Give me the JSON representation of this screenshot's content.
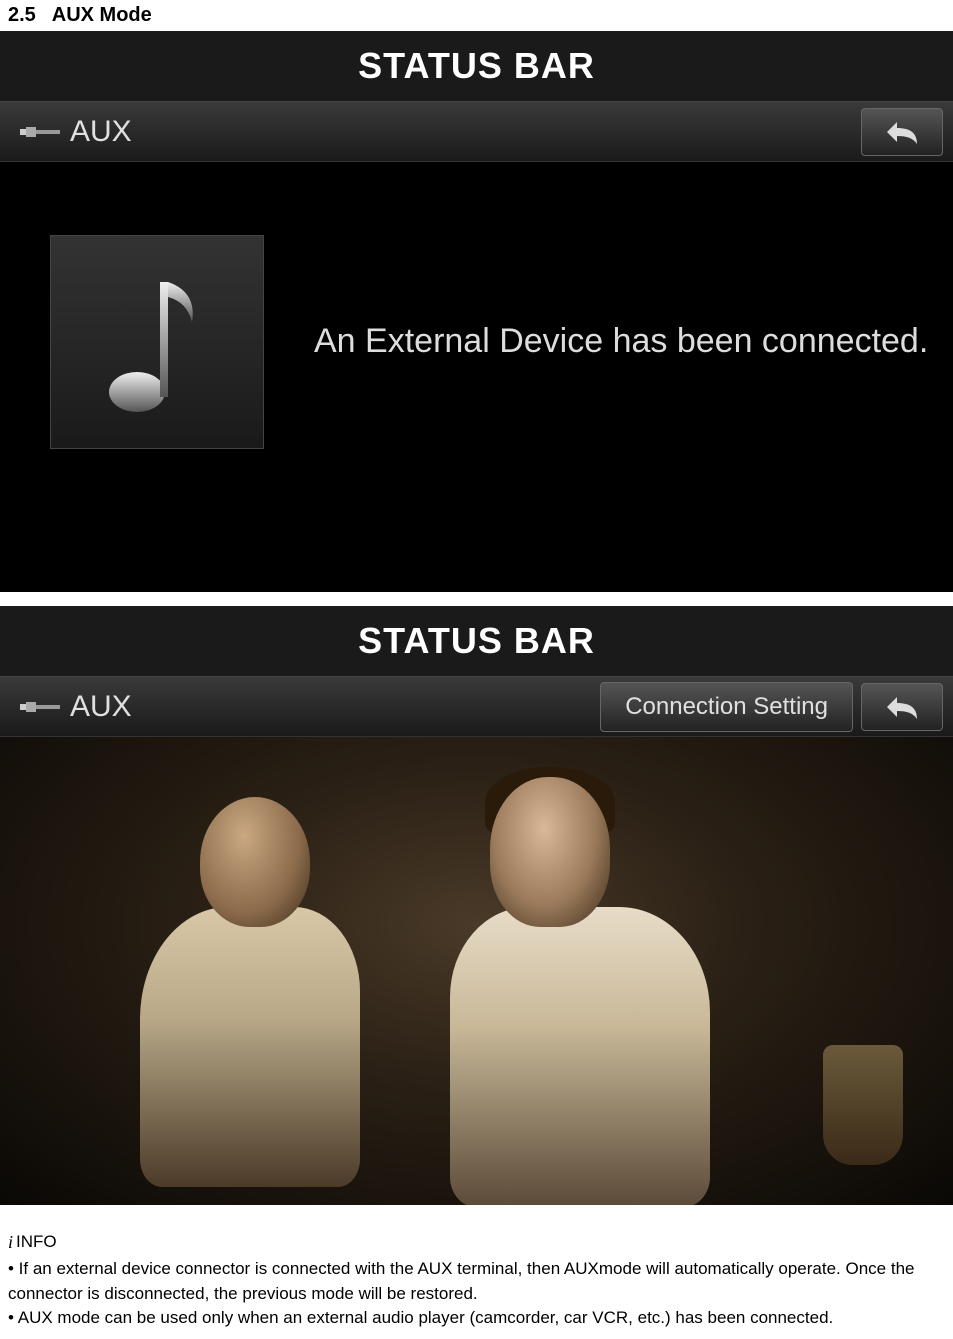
{
  "section": {
    "number": "2.5",
    "title": "AUX Mode"
  },
  "screen1": {
    "status_bar": "STATUS BAR",
    "header": {
      "aux_label": "AUX"
    },
    "message": "An External Device has been connected."
  },
  "screen2": {
    "status_bar": "STATUS BAR",
    "header": {
      "aux_label": "AUX",
      "connection_setting": "Connection Setting"
    }
  },
  "info": {
    "icon": "i",
    "label": "INFO",
    "bullets": [
      "• If an external device connector is connected with the AUX terminal, then AUXmode will automatically operate. Once the connector is disconnected, the previous mode will be restored.",
      "• AUX mode can be used only when an external audio player (camcorder, car VCR, etc.) has been connected."
    ]
  }
}
